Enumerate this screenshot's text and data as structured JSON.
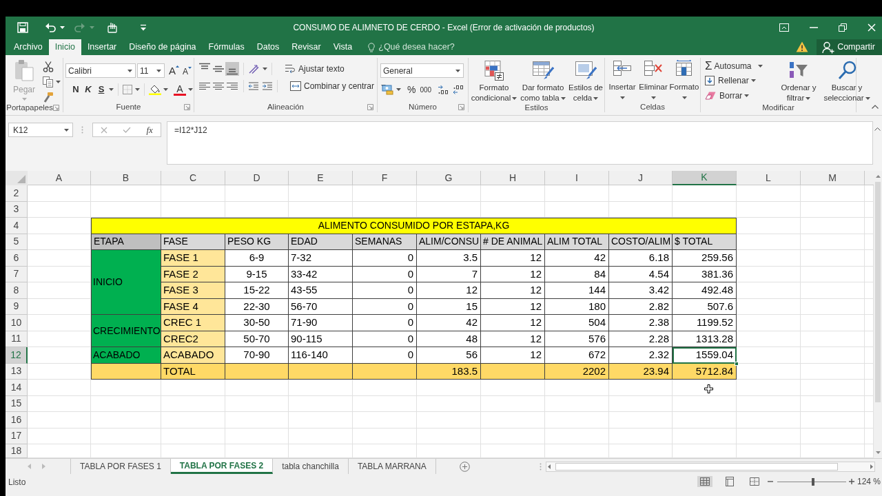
{
  "window": {
    "title": "CONSUMO DE ALIMNETO DE CERDO - Excel (Error de activación de productos)"
  },
  "quick_access": [
    {
      "kind": "save",
      "disabled": false
    },
    {
      "kind": "undo",
      "disabled": false
    },
    {
      "kind": "redo",
      "disabled": true
    },
    {
      "kind": "touch",
      "disabled": false
    },
    {
      "kind": "customize",
      "disabled": false
    }
  ],
  "ribbon_tabs": [
    {
      "label": "Archivo",
      "selected": false
    },
    {
      "label": "Inicio",
      "selected": true
    },
    {
      "label": "Insertar",
      "selected": false
    },
    {
      "label": "Diseño de página",
      "selected": false
    },
    {
      "label": "Fórmulas",
      "selected": false
    },
    {
      "label": "Datos",
      "selected": false
    },
    {
      "label": "Revisar",
      "selected": false
    },
    {
      "label": "Vista",
      "selected": false
    }
  ],
  "tell_me": {
    "placeholder": "¿Qué desea hacer?"
  },
  "share_button": {
    "label": "Compartir"
  },
  "ribbon": {
    "clipboard": {
      "paste": {
        "label": "Pegar",
        "disabled": true
      },
      "group": "Portapapeles"
    },
    "font": {
      "name": "Calibri",
      "size": "11",
      "grow": "A",
      "shrink": "A",
      "bold": "N",
      "italic": "K",
      "underline": "S",
      "font_color_button": "A",
      "group": "Fuente"
    },
    "alignment": {
      "vertical": [
        {
          "kind": "top",
          "selected": false
        },
        {
          "kind": "middle",
          "selected": false
        },
        {
          "kind": "bottom",
          "selected": true
        }
      ],
      "wrap": "Ajustar texto",
      "merge": "Combinar y centrar",
      "group": "Alineación"
    },
    "number": {
      "format": "General",
      "percent": "%",
      "thousands": "000",
      "group": "Número"
    },
    "styles": {
      "buttons": [
        {
          "kind": "conditional",
          "label": "Formato condicional"
        },
        {
          "kind": "table",
          "label": "Dar formato como tabla"
        },
        {
          "kind": "cell",
          "label": "Estilos de celda"
        }
      ],
      "group": "Estilos"
    },
    "cells": {
      "buttons": [
        {
          "kind": "insert",
          "label": "Insertar"
        },
        {
          "kind": "delete",
          "label": "Eliminar"
        },
        {
          "kind": "format",
          "label": "Formato"
        }
      ],
      "group": "Celdas"
    },
    "editing": {
      "autosum": {
        "symbol": "Σ",
        "label": "Autosuma"
      },
      "fill": "Rellenar",
      "clear": "Borrar",
      "sort": "Ordenar y filtrar",
      "find": "Buscar y seleccionar",
      "group": "Modificar"
    }
  },
  "formula_bar": {
    "name_box": "K12",
    "function_button": "fx",
    "formula": "=I12*J12"
  },
  "columns": [
    {
      "label": "A",
      "selected": false
    },
    {
      "label": "B",
      "selected": false
    },
    {
      "label": "C",
      "selected": false
    },
    {
      "label": "D",
      "selected": false
    },
    {
      "label": "E",
      "selected": false
    },
    {
      "label": "F",
      "selected": false
    },
    {
      "label": "G",
      "selected": false
    },
    {
      "label": "H",
      "selected": false
    },
    {
      "label": "I",
      "selected": false
    },
    {
      "label": "J",
      "selected": false
    },
    {
      "label": "K",
      "selected": true
    },
    {
      "label": "L",
      "selected": false
    },
    {
      "label": "M",
      "selected": false
    }
  ],
  "rows": [
    {
      "label": "2",
      "selected": false
    },
    {
      "label": "3",
      "selected": false
    },
    {
      "label": "4",
      "selected": false
    },
    {
      "label": "5",
      "selected": false
    },
    {
      "label": "6",
      "selected": false
    },
    {
      "label": "7",
      "selected": false
    },
    {
      "label": "8",
      "selected": false
    },
    {
      "label": "9",
      "selected": false
    },
    {
      "label": "10",
      "selected": false
    },
    {
      "label": "11",
      "selected": false
    },
    {
      "label": "12",
      "selected": true
    },
    {
      "label": "13",
      "selected": false
    },
    {
      "label": "14",
      "selected": false
    },
    {
      "label": "15",
      "selected": false
    },
    {
      "label": "16",
      "selected": false
    },
    {
      "label": "17",
      "selected": false
    },
    {
      "label": "18",
      "selected": false
    }
  ],
  "table": {
    "title": "ALIMENTO CONSUMIDO POR ESTAPA,KG",
    "headers": [
      "ETAPA",
      "FASE",
      "PESO KG",
      "EDAD",
      "SEMANAS",
      "ALIM/CONSU",
      "# DE ANIMAL",
      "ALIM TOTAL",
      "COSTO/ALIM",
      "$ TOTAL"
    ],
    "stages": [
      {
        "label": "INICIO",
        "phases": [
          {
            "phase": "FASE 1",
            "values": [
              "6-9",
              "7-32",
              "0",
              "3.5",
              "12",
              "42",
              "6.18",
              "259.56"
            ]
          },
          {
            "phase": "FASE 2",
            "values": [
              "9-15",
              "33-42",
              "0",
              "7",
              "12",
              "84",
              "4.54",
              "381.36"
            ]
          },
          {
            "phase": "FASE 3",
            "values": [
              "15-22",
              "43-55",
              "0",
              "12",
              "12",
              "144",
              "3.42",
              "492.48"
            ]
          },
          {
            "phase": "FASE 4",
            "values": [
              "22-30",
              "56-70",
              "0",
              "15",
              "12",
              "180",
              "2.82",
              "507.6"
            ]
          }
        ]
      },
      {
        "label": "CRECIMIENTO",
        "phases": [
          {
            "phase": "CREC 1",
            "values": [
              "30-50",
              "71-90",
              "0",
              "42",
              "12",
              "504",
              "2.38",
              "1199.52"
            ]
          },
          {
            "phase": "CREC2",
            "values": [
              "50-70",
              "90-115",
              "0",
              "48",
              "12",
              "576",
              "2.28",
              "1313.28"
            ]
          }
        ]
      },
      {
        "label": "ACABADO",
        "phases": [
          {
            "phase": "ACABADO",
            "values": [
              "70-90",
              "116-140",
              "0",
              "56",
              "12",
              "672",
              "2.32",
              "1559.04"
            ]
          }
        ]
      }
    ],
    "total": {
      "label": "TOTAL",
      "cells": [
        {},
        {},
        {},
        {
          "value": "183.5"
        },
        {},
        {
          "value": "2202"
        },
        {
          "value": "23.94"
        },
        {
          "value": "5712.84"
        }
      ]
    }
  },
  "sheet_tabs": [
    {
      "label": "TABLA POR FASES 1",
      "selected": false
    },
    {
      "label": "TABLA POR FASES 2",
      "selected": true
    },
    {
      "label": "tabla chanchilla",
      "selected": false
    },
    {
      "label": "TABLA MARRANA",
      "selected": false
    }
  ],
  "status_bar": {
    "status": "Listo",
    "views": [
      {
        "kind": "normal",
        "selected": true
      },
      {
        "kind": "page_layout",
        "selected": false
      },
      {
        "kind": "page_break",
        "selected": false
      }
    ],
    "zoom_slider": {
      "level": 0.52
    },
    "zoom": "124 %"
  }
}
